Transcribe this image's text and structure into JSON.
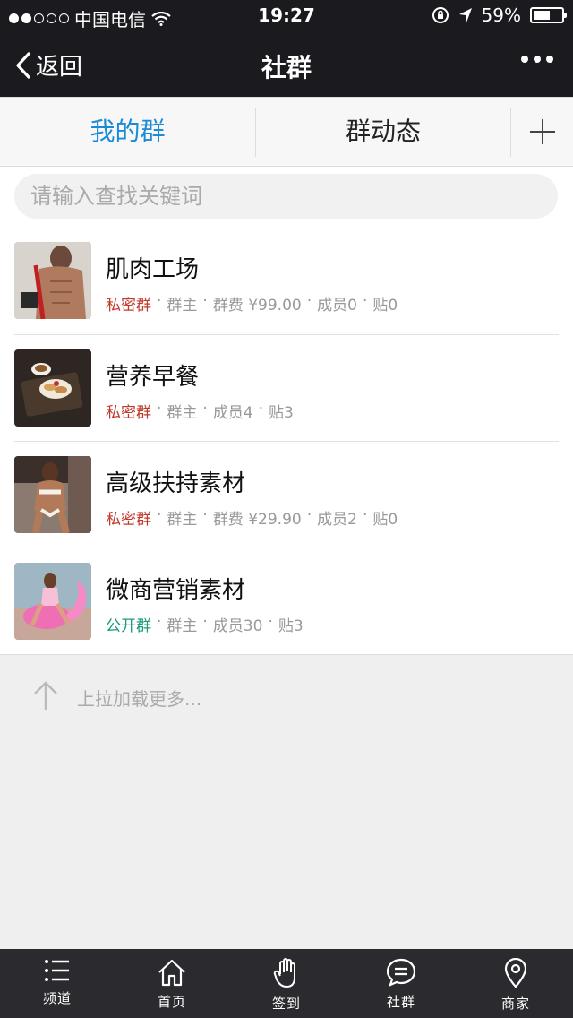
{
  "status": {
    "carrier": "中国电信",
    "time": "19:27",
    "battery": "59%",
    "battery_level": 0.59
  },
  "nav": {
    "back_label": "返回",
    "title": "社群"
  },
  "tabs": [
    {
      "label": "我的群",
      "active": true
    },
    {
      "label": "群动态",
      "active": false
    }
  ],
  "search": {
    "placeholder": "请输入查找关键词"
  },
  "groups": [
    {
      "name": "肌肉工场",
      "type": "私密群",
      "type_kind": "private",
      "parts": [
        "群主",
        "群费 ¥99.00",
        "成员0",
        "贴0"
      ]
    },
    {
      "name": "营养早餐",
      "type": "私密群",
      "type_kind": "private",
      "parts": [
        "群主",
        "成员4",
        "贴3"
      ]
    },
    {
      "name": "高级扶持素材",
      "type": "私密群",
      "type_kind": "private",
      "parts": [
        "群主",
        "群费 ¥29.90",
        "成员2",
        "贴0"
      ]
    },
    {
      "name": "微商营销素材",
      "type": "公开群",
      "type_kind": "public",
      "parts": [
        "群主",
        "成员30",
        "贴3"
      ]
    }
  ],
  "loadmore": {
    "text": "上拉加载更多..."
  },
  "bottom_tabs": [
    {
      "label": "频道",
      "icon": "list-icon"
    },
    {
      "label": "首页",
      "icon": "home-icon"
    },
    {
      "label": "签到",
      "icon": "hand-icon"
    },
    {
      "label": "社群",
      "icon": "chat-icon"
    },
    {
      "label": "商家",
      "icon": "location-pin-icon"
    }
  ],
  "colors": {
    "accent": "#1a8bd6",
    "private": "#c0392b",
    "public": "#1b9a7a",
    "topbar": "#1b1b1f",
    "bottombar": "#2b2b2f"
  }
}
